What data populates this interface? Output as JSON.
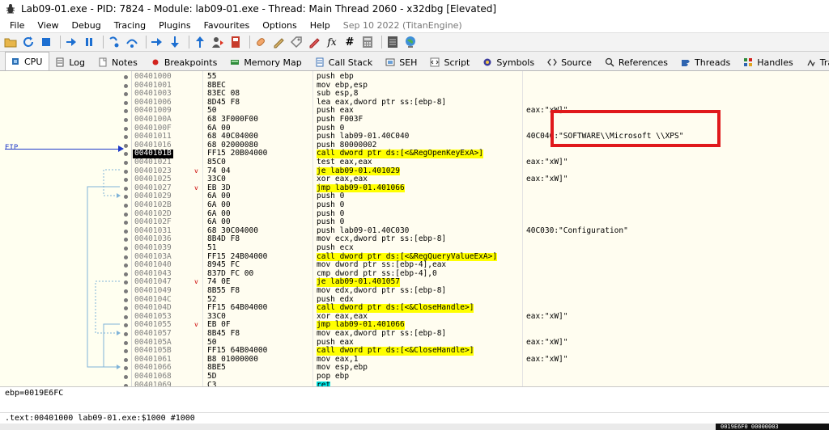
{
  "window": {
    "title": "Lab09-01.exe - PID: 7824 - Module: lab09-01.exe - Thread: Main Thread 2060 - x32dbg [Elevated]"
  },
  "menu": [
    "File",
    "View",
    "Debug",
    "Tracing",
    "Plugins",
    "Favourites",
    "Options",
    "Help"
  ],
  "menu_date": "Sep 10 2022 (TitanEngine)",
  "toolbar_icons": [
    "open-icon",
    "restart-icon",
    "stop-icon",
    "run-icon",
    "pause-icon",
    "step-into-icon",
    "step-over-icon",
    "trace-into-icon",
    "trace-over-icon",
    "execute-till-return-icon",
    "run-to-user-code-icon",
    "scylla-icon",
    "patch-icon",
    "comment-icon",
    "label-icon",
    "bookmark-icon",
    "function-icon",
    "hash-icon",
    "calculator-icon",
    "notes-icon",
    "web-icon"
  ],
  "tabs": [
    {
      "label": "CPU",
      "icon": "cpu-icon",
      "active": true
    },
    {
      "label": "Log",
      "icon": "log-icon"
    },
    {
      "label": "Notes",
      "icon": "notes-icon"
    },
    {
      "label": "Breakpoints",
      "icon": "breakpoint-icon"
    },
    {
      "label": "Memory Map",
      "icon": "memory-icon"
    },
    {
      "label": "Call Stack",
      "icon": "callstack-icon"
    },
    {
      "label": "SEH",
      "icon": "seh-icon"
    },
    {
      "label": "Script",
      "icon": "script-icon"
    },
    {
      "label": "Symbols",
      "icon": "symbols-icon"
    },
    {
      "label": "Source",
      "icon": "source-icon"
    },
    {
      "label": "References",
      "icon": "references-icon"
    },
    {
      "label": "Threads",
      "icon": "threads-icon"
    },
    {
      "label": "Handles",
      "icon": "handles-icon"
    },
    {
      "label": "Tra",
      "icon": "trace-icon"
    }
  ],
  "eip_label": "EIP",
  "disasm": [
    {
      "addr": "00401000",
      "bytes": "55",
      "instr": "push ebp",
      "kind": "push",
      "comment": ""
    },
    {
      "addr": "00401001",
      "bytes": "8BEC",
      "instr": "mov ebp,esp",
      "kind": "mov",
      "comment": ""
    },
    {
      "addr": "00401003",
      "bytes": "83EC 08",
      "instr": "sub esp,8",
      "kind": "mov",
      "comment": ""
    },
    {
      "addr": "00401006",
      "bytes": "8D45 F8",
      "instr": "lea eax,dword ptr ss:[ebp-8]",
      "kind": "mov",
      "comment": ""
    },
    {
      "addr": "00401009",
      "bytes": "50",
      "instr": "push eax",
      "kind": "push",
      "comment": "eax:\"xW]\""
    },
    {
      "addr": "0040100A",
      "bytes": "68 3F000F00",
      "instr": "push F003F",
      "kind": "push",
      "comment": ""
    },
    {
      "addr": "0040100F",
      "bytes": "6A 00",
      "instr": "push 0",
      "kind": "push",
      "comment": ""
    },
    {
      "addr": "00401011",
      "bytes": "68 40C04000",
      "instr": "push lab09-01.40C040",
      "kind": "push",
      "comment": "40C040:\"SOFTWARE\\\\Microsoft \\\\XPS\""
    },
    {
      "addr": "00401016",
      "bytes": "68 02000080",
      "instr": "push 80000002",
      "kind": "push",
      "comment": ""
    },
    {
      "addr": "0040101B",
      "bytes": "FF15 20B04000",
      "instr": "call dword ptr ds:[<&RegOpenKeyExA>]",
      "kind": "call",
      "comment": "",
      "current": true
    },
    {
      "addr": "00401021",
      "bytes": "85C0",
      "instr": "test eax,eax",
      "kind": "mov",
      "comment": "eax:\"xW]\""
    },
    {
      "addr": "00401023",
      "bytes": "74 04",
      "instr": "je lab09-01.401029",
      "kind": "jmp",
      "comment": "",
      "mark": "v"
    },
    {
      "addr": "00401025",
      "bytes": "33C0",
      "instr": "xor eax,eax",
      "kind": "mov",
      "comment": "eax:\"xW]\""
    },
    {
      "addr": "00401027",
      "bytes": "EB 3D",
      "instr": "jmp lab09-01.401066",
      "kind": "jmp",
      "comment": "",
      "mark": "v"
    },
    {
      "addr": "00401029",
      "bytes": "6A 00",
      "instr": "push 0",
      "kind": "push",
      "comment": ""
    },
    {
      "addr": "0040102B",
      "bytes": "6A 00",
      "instr": "push 0",
      "kind": "push",
      "comment": ""
    },
    {
      "addr": "0040102D",
      "bytes": "6A 00",
      "instr": "push 0",
      "kind": "push",
      "comment": ""
    },
    {
      "addr": "0040102F",
      "bytes": "6A 00",
      "instr": "push 0",
      "kind": "push",
      "comment": ""
    },
    {
      "addr": "00401031",
      "bytes": "68 30C04000",
      "instr": "push lab09-01.40C030",
      "kind": "push",
      "comment": "40C030:\"Configuration\""
    },
    {
      "addr": "00401036",
      "bytes": "8B4D F8",
      "instr": "mov ecx,dword ptr ss:[ebp-8]",
      "kind": "mov",
      "comment": ""
    },
    {
      "addr": "00401039",
      "bytes": "51",
      "instr": "push ecx",
      "kind": "push",
      "comment": ""
    },
    {
      "addr": "0040103A",
      "bytes": "FF15 24B04000",
      "instr": "call dword ptr ds:[<&RegQueryValueExA>]",
      "kind": "call",
      "comment": ""
    },
    {
      "addr": "00401040",
      "bytes": "8945 FC",
      "instr": "mov dword ptr ss:[ebp-4],eax",
      "kind": "mov",
      "comment": ""
    },
    {
      "addr": "00401043",
      "bytes": "837D FC 00",
      "instr": "cmp dword ptr ss:[ebp-4],0",
      "kind": "mov",
      "comment": ""
    },
    {
      "addr": "00401047",
      "bytes": "74 0E",
      "instr": "je lab09-01.401057",
      "kind": "jmp",
      "comment": "",
      "mark": "v"
    },
    {
      "addr": "00401049",
      "bytes": "8B55 F8",
      "instr": "mov edx,dword ptr ss:[ebp-8]",
      "kind": "mov",
      "comment": ""
    },
    {
      "addr": "0040104C",
      "bytes": "52",
      "instr": "push edx",
      "kind": "push",
      "comment": ""
    },
    {
      "addr": "0040104D",
      "bytes": "FF15 64B04000",
      "instr": "call dword ptr ds:[<&CloseHandle>]",
      "kind": "call",
      "comment": ""
    },
    {
      "addr": "00401053",
      "bytes": "33C0",
      "instr": "xor eax,eax",
      "kind": "mov",
      "comment": "eax:\"xW]\""
    },
    {
      "addr": "00401055",
      "bytes": "EB 0F",
      "instr": "jmp lab09-01.401066",
      "kind": "jmp",
      "comment": "",
      "mark": "v"
    },
    {
      "addr": "00401057",
      "bytes": "8B45 F8",
      "instr": "mov eax,dword ptr ss:[ebp-8]",
      "kind": "mov",
      "comment": ""
    },
    {
      "addr": "0040105A",
      "bytes": "50",
      "instr": "push eax",
      "kind": "push",
      "comment": "eax:\"xW]\""
    },
    {
      "addr": "0040105B",
      "bytes": "FF15 64B04000",
      "instr": "call dword ptr ds:[<&CloseHandle>]",
      "kind": "call",
      "comment": ""
    },
    {
      "addr": "00401061",
      "bytes": "B8 01000000",
      "instr": "mov eax,1",
      "kind": "mov",
      "comment": "eax:\"xW]\""
    },
    {
      "addr": "00401066",
      "bytes": "8BE5",
      "instr": "mov esp,ebp",
      "kind": "mov",
      "comment": ""
    },
    {
      "addr": "00401068",
      "bytes": "5D",
      "instr": "pop ebp",
      "kind": "push",
      "comment": ""
    },
    {
      "addr": "00401069",
      "bytes": "C3",
      "instr": "ret",
      "kind": "ret",
      "comment": ""
    }
  ],
  "info_line": "ebp=0019E6FC",
  "location_line": ".text:00401000 lab09-01.exe:$1000 #1000",
  "bottom_addr": "0019E6F0  00000003"
}
